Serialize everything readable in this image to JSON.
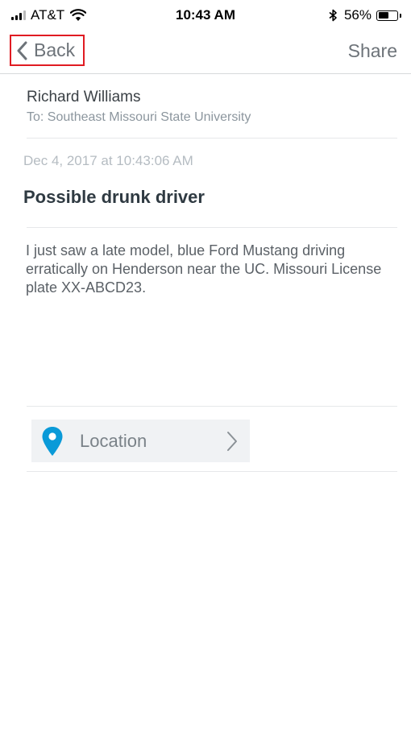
{
  "status_bar": {
    "carrier": "AT&T",
    "time": "10:43 AM",
    "battery_percent": "56%",
    "battery_level": 0.56
  },
  "nav": {
    "back_label": "Back",
    "share_label": "Share"
  },
  "message": {
    "sender": "Richard Williams",
    "recipient": "To: Southeast Missouri State University",
    "timestamp": "Dec 4, 2017 at 10:43:06 AM",
    "subject": "Possible drunk driver",
    "body": "I just saw a late model, blue Ford Mustang driving erratically on Henderson near the UC. Missouri License plate XX-ABCD23."
  },
  "location": {
    "label": "Location",
    "icon": "map-pin-icon",
    "pin_color": "#0a9ad8"
  },
  "colors": {
    "highlight": "#e01b22",
    "nav_text": "#6d7379"
  }
}
